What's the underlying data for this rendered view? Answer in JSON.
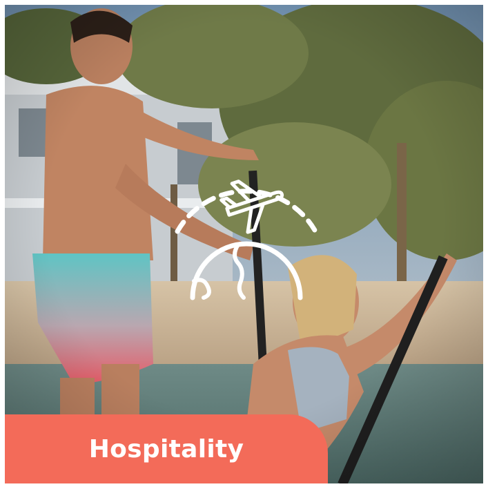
{
  "card": {
    "label": "Hospitality",
    "icon": "travel-globe-plane-icon",
    "accent_color": "#f36b59"
  },
  "photo": {
    "subject": "photo"
  }
}
